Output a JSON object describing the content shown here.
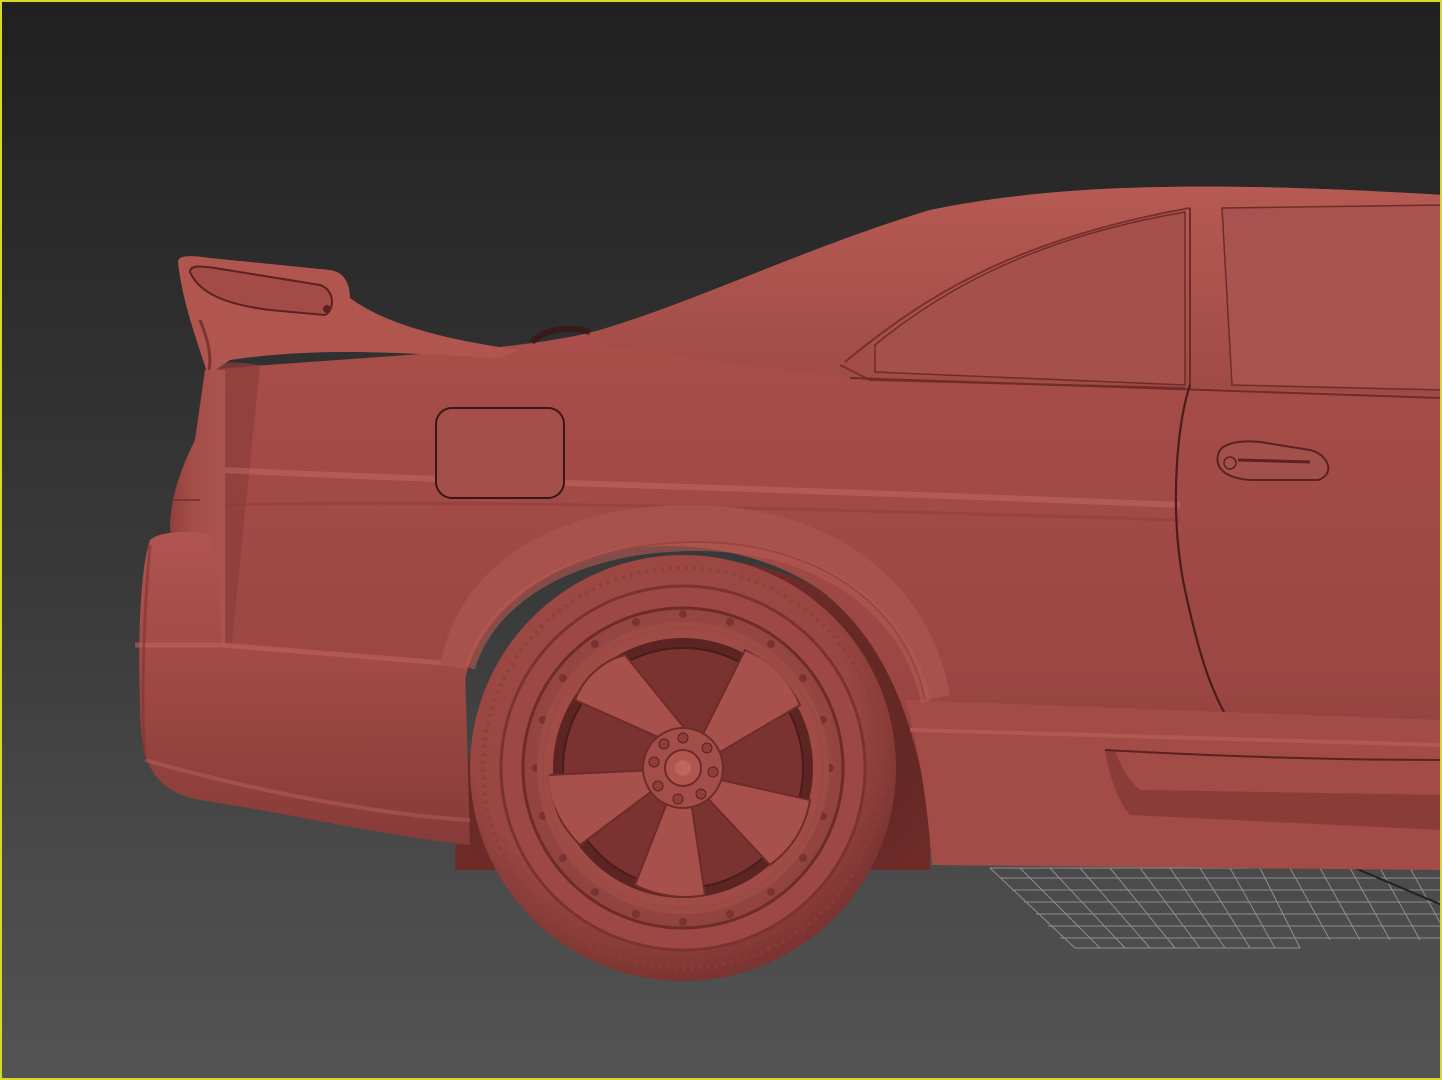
{
  "viewport": {
    "view": "perspective",
    "shading": "clay",
    "active": true
  },
  "colors": {
    "active_border": "#d8d82a",
    "background_top": "#202020",
    "background_bottom": "#535353",
    "clay_base": "#a24a46",
    "clay_shadow": "#7e3330",
    "clay_highlight": "#b9605a",
    "grid_line": "#9a9a9a"
  },
  "scene": {
    "model": "car-rear-quarter",
    "ground_grid_visible": true
  }
}
